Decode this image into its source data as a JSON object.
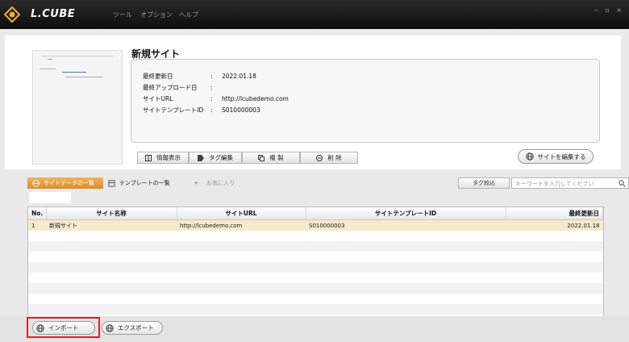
{
  "app": {
    "logo_text": "L.CUBE",
    "menu": [
      "ツール",
      "オプション",
      "ヘルプ"
    ],
    "window_controls": "‒ ▫ ×"
  },
  "site": {
    "title": "新規サイト",
    "fields": [
      {
        "label": "最終更新日",
        "value": "2022.01.18"
      },
      {
        "label": "最終アップロード日",
        "value": ""
      },
      {
        "label": "サイトURL",
        "value": "http://lcubedemo.com"
      },
      {
        "label": "サイトテンプレートID",
        "value": "S010000003"
      }
    ],
    "separator": ":"
  },
  "toolbar": {
    "info": "情報表示",
    "tag_edit": "タグ編集",
    "copy": "複 製",
    "delete": "削 除",
    "edit_site": "サイトを編集する"
  },
  "tabs": {
    "site_list": "サイトデータの一覧",
    "template_list": "テンプレートの一覧",
    "favorites": "お気に入り",
    "tag_filter": "タグ絞込",
    "search_placeholder": "キーワードを入力してください"
  },
  "table": {
    "columns": [
      "No.",
      "サイト名称",
      "サイトURL",
      "サイトテンプレートID",
      "最終更新日"
    ],
    "rows": [
      {
        "no": "1",
        "name": "新規サイト",
        "url": "http://lcubedemo.com",
        "template_id": "S010000003",
        "updated": "2022.01.18"
      }
    ]
  },
  "bottom": {
    "import": "インポート",
    "export": "エクスポート"
  },
  "colors": {
    "accent": "#d98e26",
    "highlight": "#e02020",
    "selected_row": "#f6e9cc"
  }
}
